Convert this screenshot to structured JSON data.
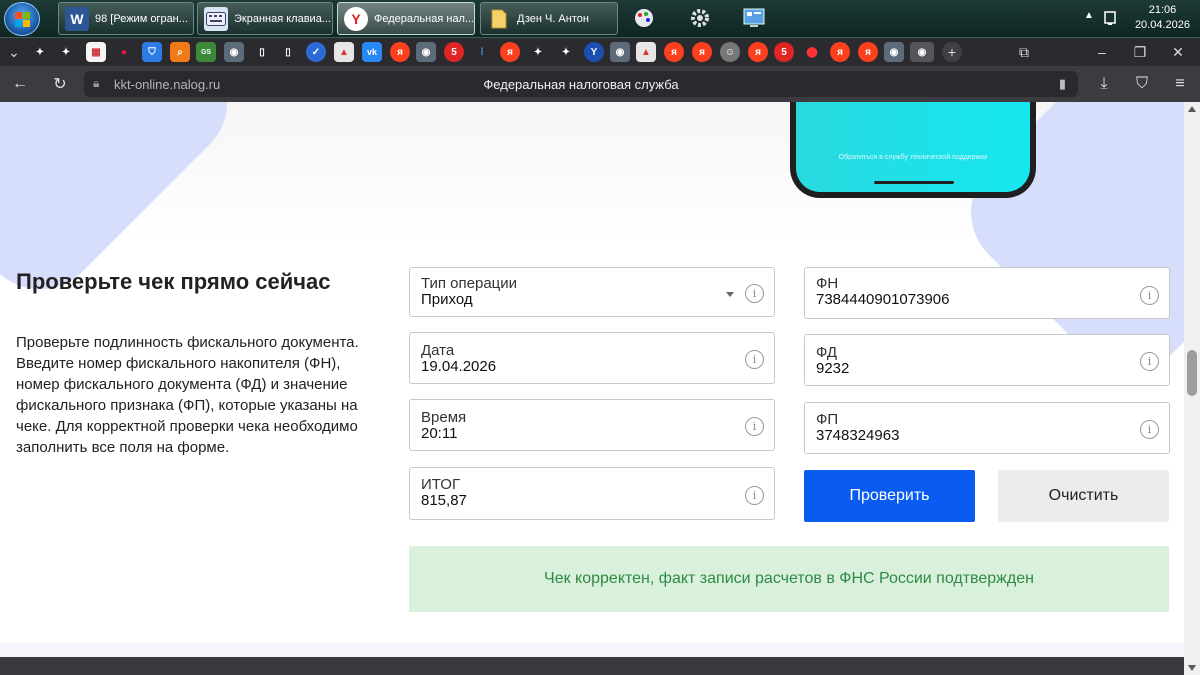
{
  "taskbar": {
    "tasks": [
      {
        "label": "98 [Режим огран...",
        "icon": "word-icon"
      },
      {
        "label": "Экранная клавиа...",
        "icon": "keyboard-icon"
      },
      {
        "label": "Федеральная нал...",
        "icon": "yandex-browser-icon"
      },
      {
        "label": "Дзен Ч. Антон",
        "icon": "folder-icon"
      }
    ],
    "clock_time": "21:06",
    "clock_date": "20.04.2026"
  },
  "browser": {
    "url": "kkt-online.nalog.ru",
    "title": "Федеральная налоговая служба"
  },
  "page": {
    "phone_text": "Обратиться в службу технической поддержки",
    "heading": "Проверьте чек прямо сейчас",
    "description": "Проверьте подлинность фискального документа. Введите номер фискального накопителя (ФН), номер фискального документа (ФД) и значение фискального признака (ФП), которые указаны на чеке. Для корректной проверки чека необходимо заполнить все поля на форме.",
    "form": {
      "operation_type": {
        "label": "Тип операции",
        "value": "Приход"
      },
      "date": {
        "label": "Дата",
        "value": "19.04.2026"
      },
      "time": {
        "label": "Время",
        "value": "20:11"
      },
      "total": {
        "label": "ИТОГ",
        "value": "815,87"
      },
      "fn": {
        "label": "ФН",
        "value": "7384440901073906"
      },
      "fd": {
        "label": "ФД",
        "value": "9232"
      },
      "fp": {
        "label": "ФП",
        "value": "3748324963"
      },
      "info_glyph": "i"
    },
    "check_button": "Проверить",
    "clear_button": "Очистить",
    "result_message": "Чек корректен, факт записи расчетов в ФНС России подтвержден"
  },
  "colors": {
    "primary": "#0a5cf0",
    "success_bg": "#d9f0dd",
    "success_text": "#2f8a43"
  }
}
